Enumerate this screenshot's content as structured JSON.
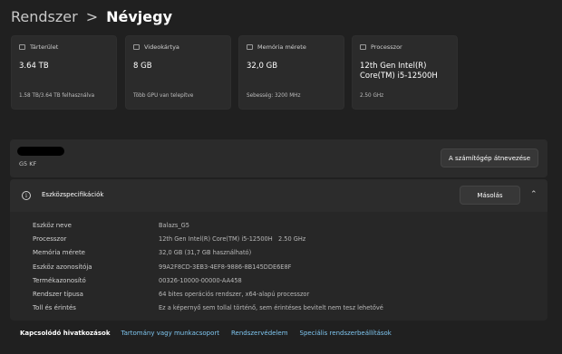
{
  "breadcrumb": {
    "parent": "Rendszer",
    "separator": ">",
    "current": "Névjegy"
  },
  "cards": [
    {
      "icon": "storage-icon",
      "label": "Tárterület",
      "value": "3.64 TB",
      "sub": "1.58 TB/3.64 TB felhasználva"
    },
    {
      "icon": "gpu-icon",
      "label": "Videokártya",
      "value": "8 GB",
      "sub": "Több GPU van telepítve"
    },
    {
      "icon": "memory-icon",
      "label": "Memória mérete",
      "value": "32,0 GB",
      "sub": "Sebesség: 3200 MHz"
    },
    {
      "icon": "processor-icon",
      "label": "Processzor",
      "value": "12th Gen Intel(R) Core(TM) i5-12500H",
      "sub": "2.50 GHz"
    }
  ],
  "device": {
    "model": "G5 KF",
    "rename_label": "A számítógép átnevezése"
  },
  "specs": {
    "title": "Eszközspecifikációk",
    "copy_label": "Másolás",
    "rows": [
      {
        "key": "Eszköz neve",
        "value": "Balazs_G5"
      },
      {
        "key": "Processzor",
        "value": "12th Gen Intel(R) Core(TM) i5-12500H   2.50 GHz"
      },
      {
        "key": "Memória mérete",
        "value": "32,0 GB (31,7 GB használható)"
      },
      {
        "key": "Eszköz azonosítója",
        "value": "99A2F8CD-3EB3-4EF8-9886-8B145DDE6E8F"
      },
      {
        "key": "Termékazonosító",
        "value": "00326-10000-00000-AA458"
      },
      {
        "key": "Rendszer típusa",
        "value": "64 bites operációs rendszer, x64-alapú processzor"
      },
      {
        "key": "Toll és érintés",
        "value": "Ez a képernyő sem tollal történő, sem érintéses bevitelt nem tesz lehetővé"
      }
    ]
  },
  "related": {
    "title": "Kapcsolódó hivatkozások",
    "links": [
      "Tartomány vagy munkacsoport",
      "Rendszervédelem",
      "Speciális rendszerbeállítások"
    ]
  }
}
